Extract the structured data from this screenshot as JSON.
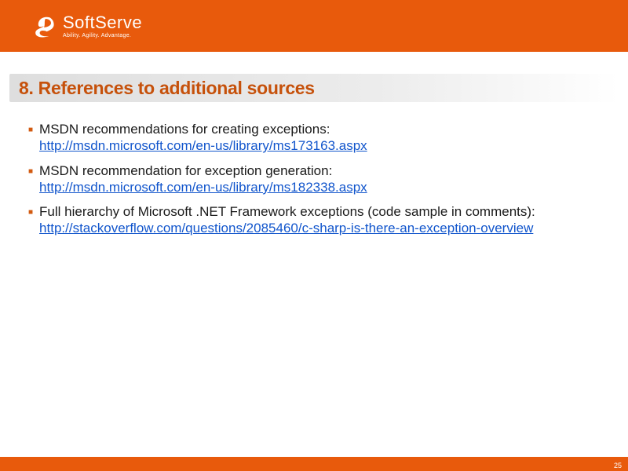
{
  "logo": {
    "name": "SoftServe",
    "tagline": "Ability. Agility. Advantage."
  },
  "title": "8. References to additional sources",
  "items": [
    {
      "text": "MSDN recommendations for creating exceptions:",
      "link": "http://msdn.microsoft.com/en-us/library/ms173163.aspx"
    },
    {
      "text": "MSDN recommendation for exception generation:",
      "link": "http://msdn.microsoft.com/en-us/library/ms182338.aspx"
    },
    {
      "text": "Full hierarchy of Microsoft .NET Framework exceptions (code sample in comments):",
      "link": "http://stackoverflow.com/questions/2085460/c-sharp-is-there-an-exception-overview"
    }
  ],
  "pageNumber": "25"
}
